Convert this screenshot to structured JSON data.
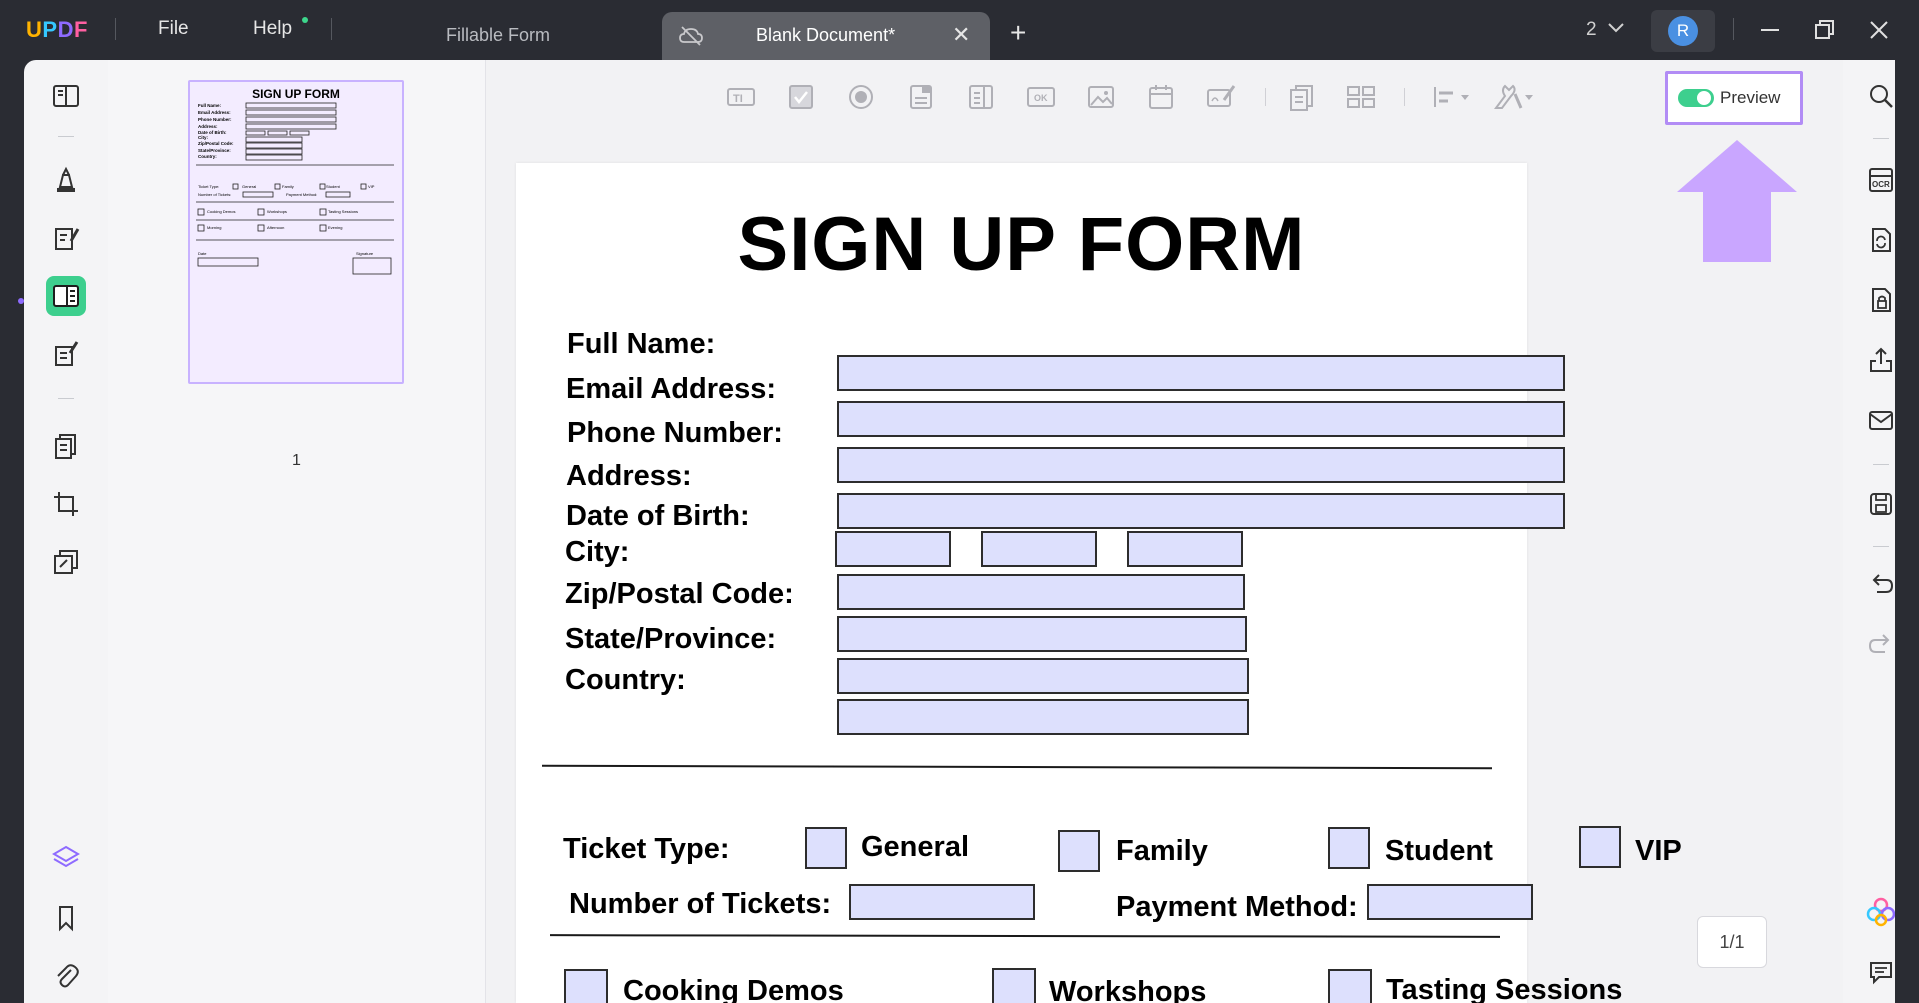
{
  "app": {
    "logo": "UPDF",
    "menu": {
      "file": "File",
      "help": "Help"
    },
    "tabs": [
      {
        "label": "Fillable Form",
        "active": false
      },
      {
        "label": "Blank Document*",
        "active": true
      }
    ],
    "window_count": "2",
    "user_initial": "R"
  },
  "thumbnails": {
    "pages": [
      {
        "number": "1",
        "title": "SIGN UP FORM"
      }
    ]
  },
  "toolbar": {
    "preview_label": "Preview"
  },
  "form": {
    "title": "SIGN UP FORM",
    "labels": {
      "full_name": "Full Name:",
      "email": "Email Address:",
      "phone": "Phone Number:",
      "address": "Address:",
      "dob": "Date of Birth:",
      "city": "City:",
      "zip": "Zip/Postal Code:",
      "state": "State/Province:",
      "country": "Country:",
      "ticket_type": "Ticket Type:",
      "general": "General",
      "family": "Family",
      "student": "Student",
      "vip": "VIP",
      "num_tickets": "Number of Tickets:",
      "payment": "Payment Method:",
      "cooking": "Cooking Demos",
      "workshops": "Workshops",
      "tasting": "Tasting Sessions"
    }
  },
  "page_indicator": "1/1",
  "colors": {
    "accent_green": "#3dcf8e",
    "highlight_purple": "#b28cf5",
    "field_fill": "#dde0fd"
  }
}
